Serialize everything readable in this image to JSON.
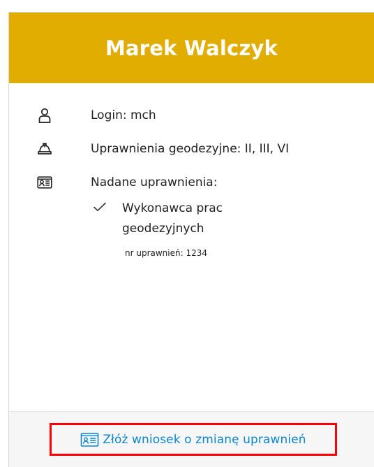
{
  "profile": {
    "name": "Marek Walczyk"
  },
  "details": {
    "login": "Login: mch",
    "surveying_rights": "Uprawnienia geodezyjne: II, III, VI",
    "granted_permissions_title": "Nadane uprawnienia:"
  },
  "permissions": [
    {
      "name": "Wykonawca prac geodezyjnych",
      "number": "nr uprawnień: 1234",
      "icon": "check-icon"
    }
  ],
  "footer": {
    "request_label": "Złóż wniosek o zmianę uprawnień",
    "request_icon": "id-card-icon"
  },
  "icons": {
    "login": "user-icon",
    "surveying_rights": "hard-hat-icon",
    "granted_permissions": "id-card-icon"
  },
  "colors": {
    "header": "#E0AD00",
    "link": "#0D86C8",
    "highlight_border": "#FF0000",
    "footer_background": "#F6F6F6"
  }
}
